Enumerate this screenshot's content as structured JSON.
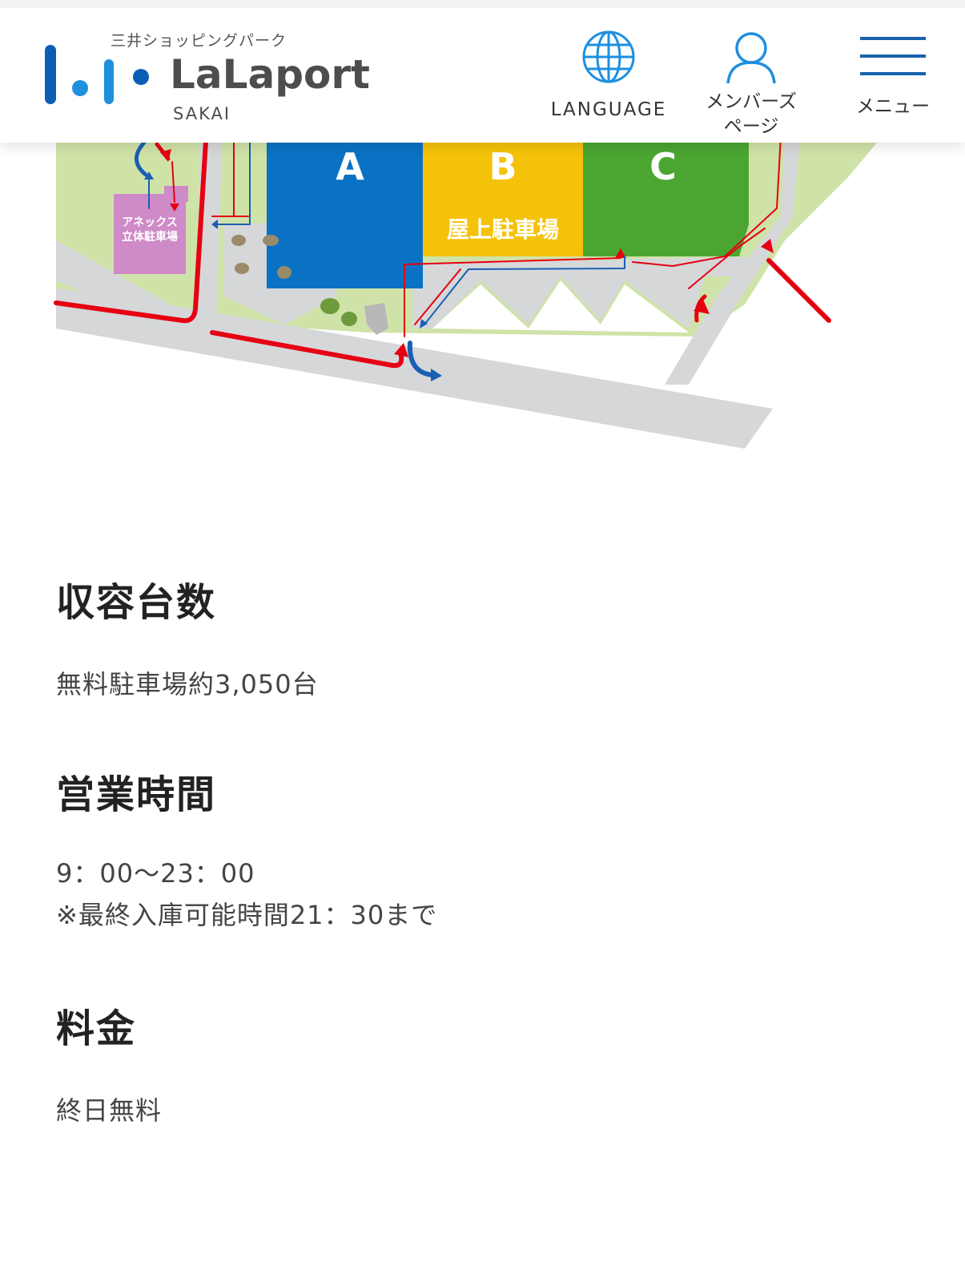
{
  "header": {
    "logo": {
      "subtitle": "三井ショッピングパーク",
      "name": "LaLaport",
      "branch": "SAKAI"
    },
    "language_label": "LANGUAGE",
    "member_label_line1": "メンバーズ",
    "member_label_line2": "ページ",
    "menu_label": "メニュー",
    "icons": {
      "language": "globe-icon",
      "member": "person-icon",
      "menu": "hamburger-icon"
    }
  },
  "map": {
    "blocks": [
      "A",
      "B",
      "C"
    ],
    "rooftop_label": "屋上駐車場",
    "annex_label_line1": "アネックス",
    "annex_label_line2": "立体駐車場",
    "colors": {
      "block_a": "#0a72c4",
      "block_b": "#f5c20a",
      "block_c": "#4aa630",
      "annex": "#cf8ac8",
      "inbound_route": "#e60012",
      "outbound_route": "#1a5fb4",
      "road": "#d6d7d9",
      "green": "#cfe3a8"
    }
  },
  "capacity": {
    "heading": "収容台数",
    "text": "無料駐車場約3,050台"
  },
  "hours": {
    "heading": "営業時間",
    "line1": "9：00〜23：00",
    "line2": "※最終入庫可能時間21：30まで"
  },
  "fee": {
    "heading": "料金",
    "text": "終日無料"
  }
}
